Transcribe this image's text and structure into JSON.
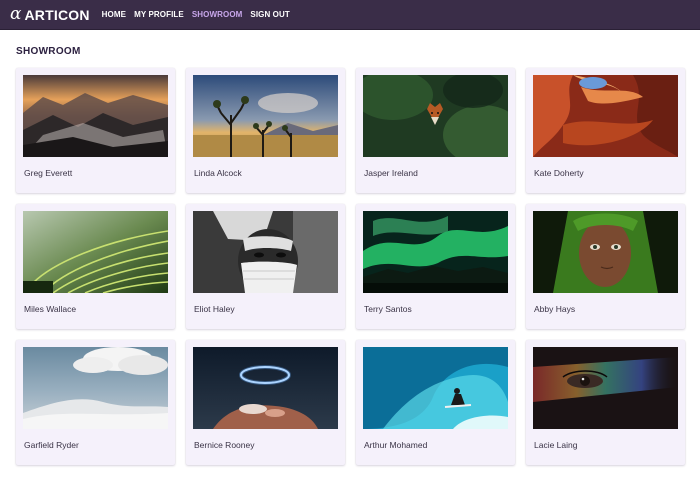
{
  "brand": {
    "logo_glyph": "α",
    "name": "ARTICON"
  },
  "nav": {
    "items": [
      {
        "label": "HOME",
        "active": false
      },
      {
        "label": "MY PROFILE",
        "active": false
      },
      {
        "label": "SHOWROOM",
        "active": true
      },
      {
        "label": "SIGN OUT",
        "active": false
      }
    ]
  },
  "page": {
    "title": "SHOWROOM"
  },
  "colors": {
    "navbar": "#3a2d48",
    "active_link": "#c7a6ea",
    "card_bg": "#f5f1fb"
  },
  "artworks": [
    {
      "artist": "Greg Everett",
      "image": "mountain-sunset-photo"
    },
    {
      "artist": "Linda Alcock",
      "image": "joshua-tree-desert-photo"
    },
    {
      "artist": "Jasper Ireland",
      "image": "fox-in-foliage-photo"
    },
    {
      "artist": "Kate Doherty",
      "image": "red-canyon-photo"
    },
    {
      "artist": "Miles Wallace",
      "image": "rice-terraces-photo"
    },
    {
      "artist": "Eliot Haley",
      "image": "masked-face-bw-photo"
    },
    {
      "artist": "Terry Santos",
      "image": "aurora-borealis-photo"
    },
    {
      "artist": "Abby Hays",
      "image": "girl-green-scarf-photo"
    },
    {
      "artist": "Garfield Ryder",
      "image": "white-dunes-clouds-photo"
    },
    {
      "artist": "Bernice Rooney",
      "image": "glowing-ring-scene-photo"
    },
    {
      "artist": "Arthur Mohamed",
      "image": "surfer-wave-photo"
    },
    {
      "artist": "Lacie Laing",
      "image": "eye-rainbow-light-photo"
    }
  ]
}
